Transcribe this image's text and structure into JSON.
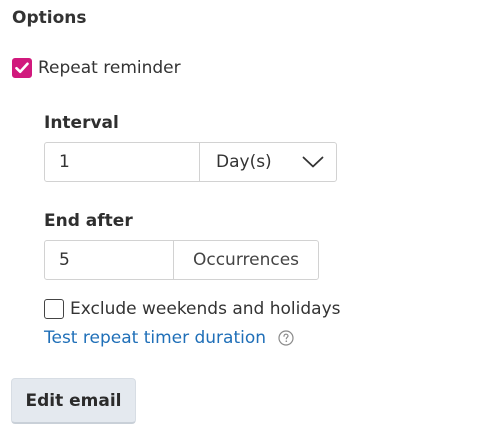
{
  "options": {
    "title": "Options",
    "repeat_reminder": {
      "label": "Repeat reminder",
      "checked": true
    },
    "interval": {
      "label": "Interval",
      "value": "1",
      "unit": "Day(s)"
    },
    "end_after": {
      "label": "End after",
      "value": "5",
      "unit": "Occurrences"
    },
    "exclude_weekends": {
      "label": "Exclude weekends and holidays",
      "checked": false
    },
    "test_link": {
      "label": "Test repeat timer duration",
      "icon": "help-circle-icon"
    },
    "edit_email_button": {
      "label": "Edit email"
    }
  },
  "colors": {
    "accent_checkbox": "#d1197d",
    "link": "#1f6fb8",
    "button_bg": "#e4e9ef",
    "border": "#d2d2d2"
  }
}
